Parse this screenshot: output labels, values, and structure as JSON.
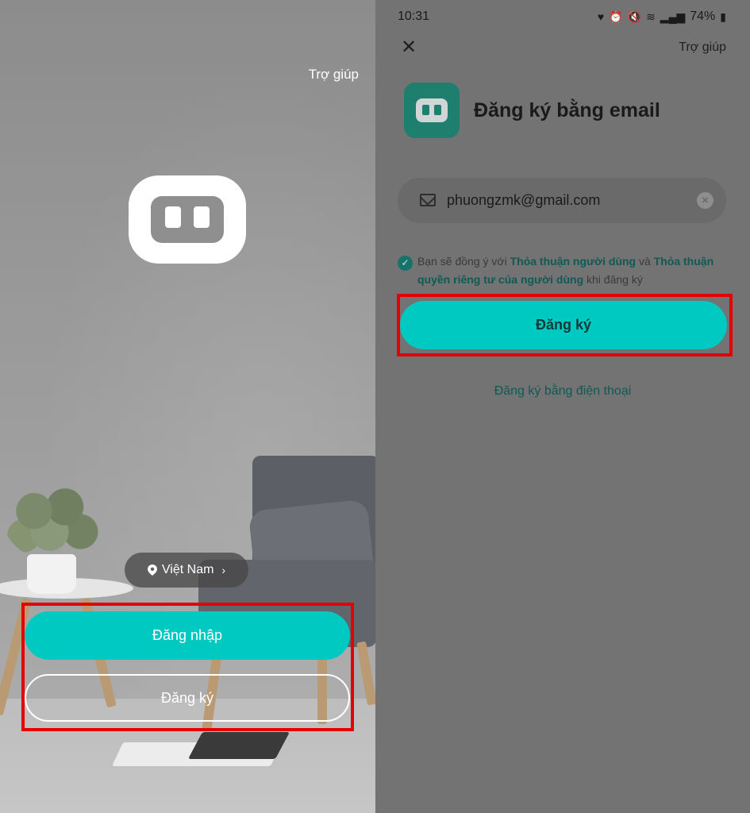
{
  "left_screen": {
    "help_label": "Trợ giúp",
    "location_label": "Việt Nam",
    "login_label": "Đăng nhập",
    "register_label": "Đăng ký"
  },
  "right_screen": {
    "status_bar": {
      "time": "10:31",
      "battery": "74%"
    },
    "help_label": "Trợ giúp",
    "title": "Đăng ký bằng email",
    "email": {
      "value": "phuongzmk@gmail.com"
    },
    "consent": {
      "prefix": "Bạn sẽ đồng ý với ",
      "link1": "Thỏa thuận người dùng",
      "middle": " và ",
      "link2": "Thỏa thuận quyền riêng tư của người dùng",
      "suffix": " khi đăng ký"
    },
    "register_button": "Đăng ký",
    "phone_register_link": "Đăng ký bằng điện thoại"
  },
  "colors": {
    "accent": "#00c9c1",
    "highlight": "#e40000"
  }
}
